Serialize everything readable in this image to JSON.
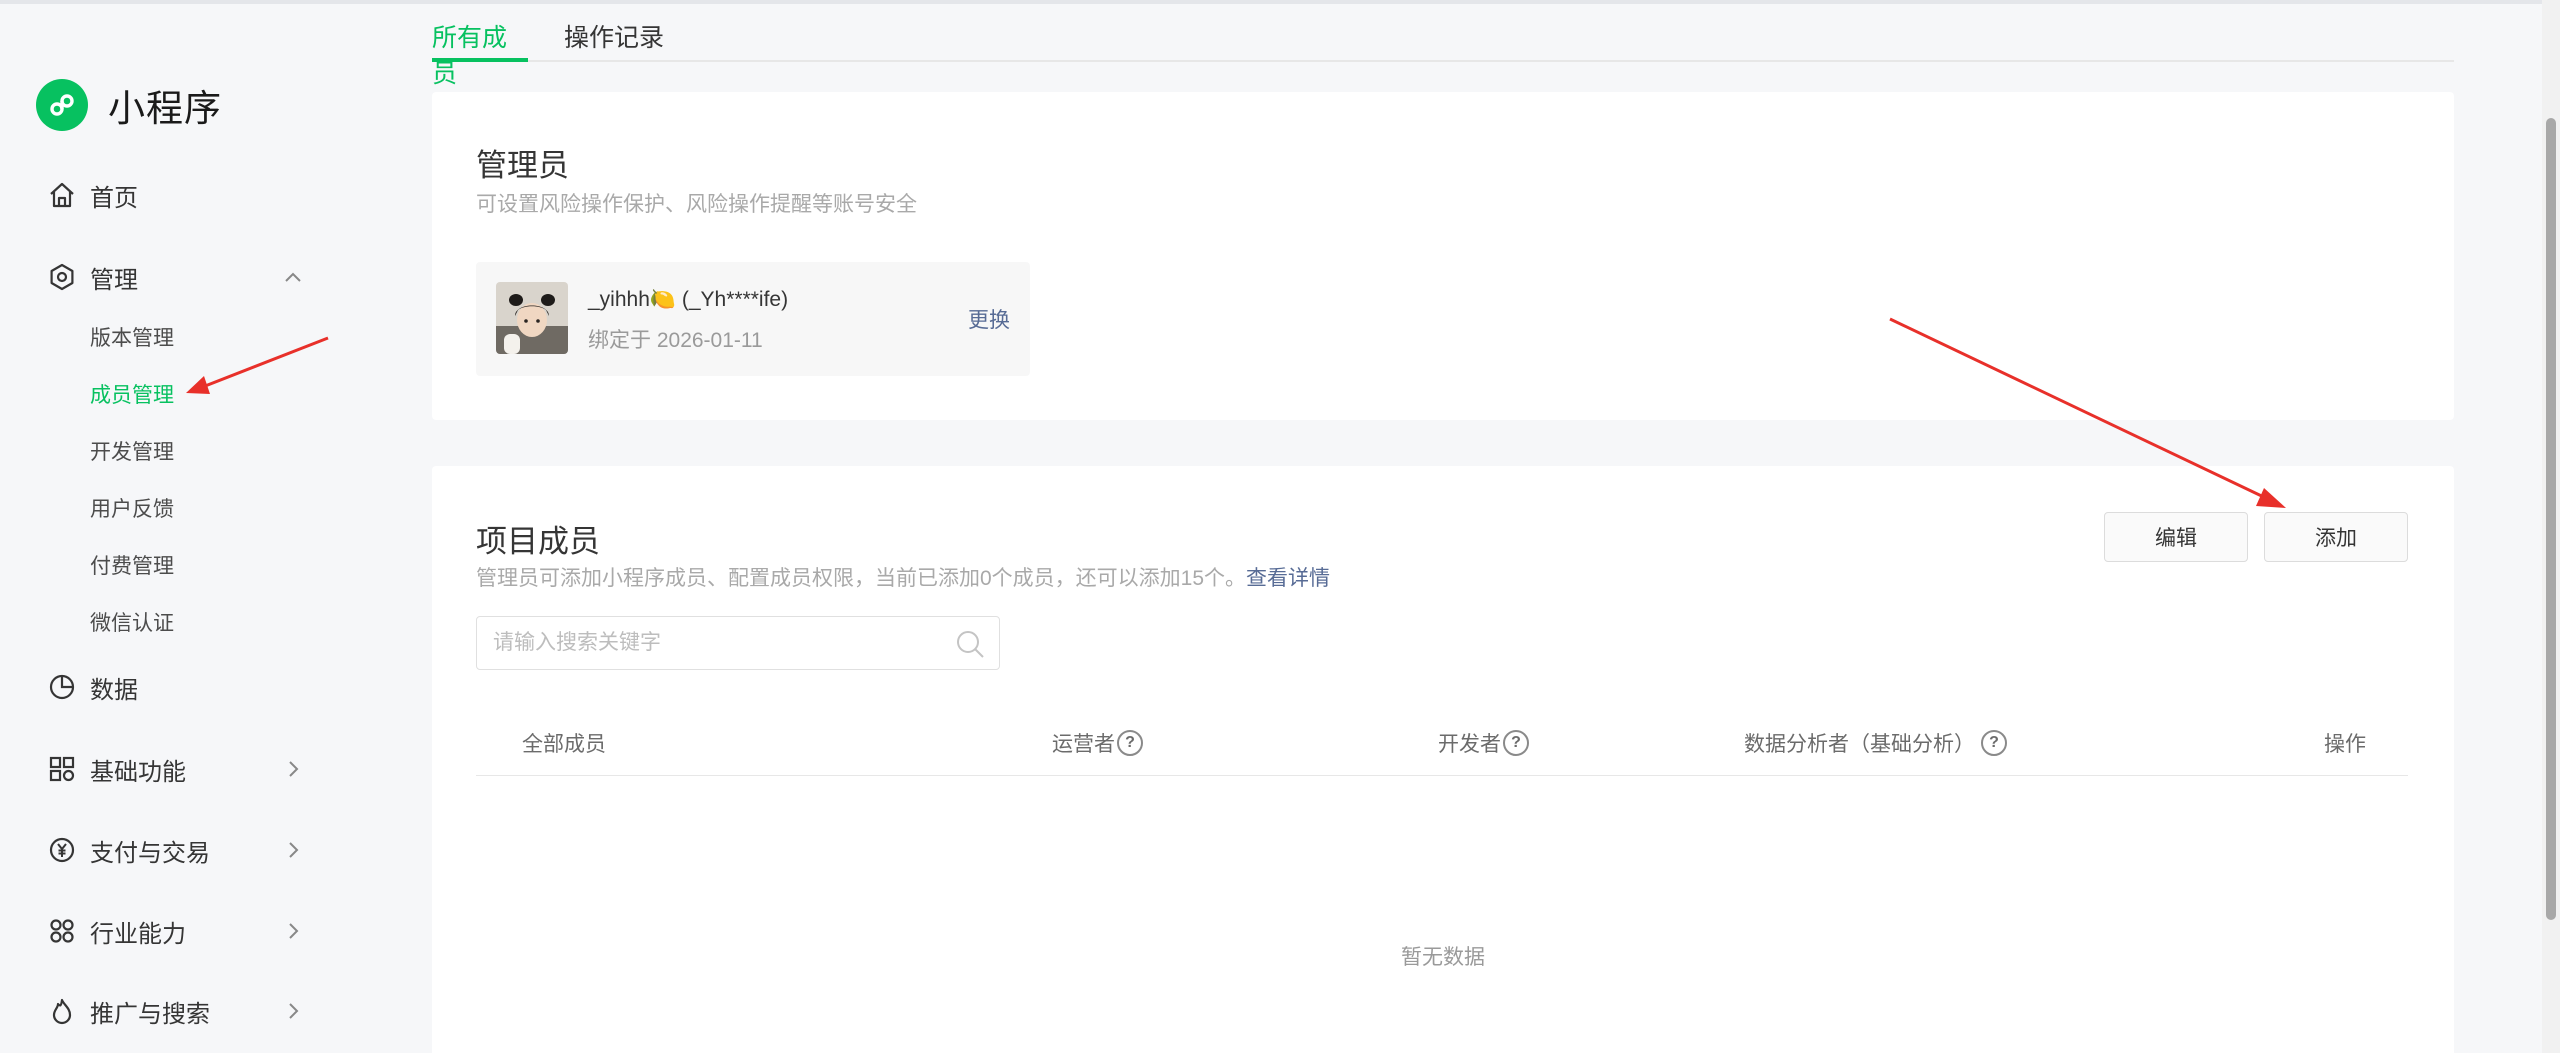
{
  "brand": {
    "name": "小程序"
  },
  "nav": {
    "home": "首页",
    "manage": "管理",
    "manage_sub": [
      "版本管理",
      "成员管理",
      "开发管理",
      "用户反馈",
      "付费管理",
      "微信认证"
    ],
    "data": "数据",
    "basic": "基础功能",
    "pay": "支付与交易",
    "industry": "行业能力",
    "promote": "推广与搜索"
  },
  "tabs": [
    "所有成员",
    "操作记录"
  ],
  "admin": {
    "title": "管理员",
    "desc": "可设置风险操作保护、风险操作提醒等账号安全",
    "name": "_yihhh🍋  (_Yh****ife)",
    "bind": "绑定于 2026-01-11",
    "change": "更换"
  },
  "members": {
    "title": "项目成员",
    "desc": "管理员可添加小程序成员、配置成员权限，当前已添加0个成员，还可以添加15个。",
    "desc_link": "查看详情",
    "edit_label": "编辑",
    "add_label": "添加",
    "search_placeholder": "请输入搜索关键字",
    "columns": {
      "all": "全部成员",
      "operator": "运营者",
      "developer": "开发者",
      "analyst": "数据分析者（基础分析）",
      "action": "操作"
    },
    "empty": "暂无数据"
  },
  "colors": {
    "accent": "#07c160",
    "link": "#576b95",
    "annotation": "#e8302a"
  }
}
